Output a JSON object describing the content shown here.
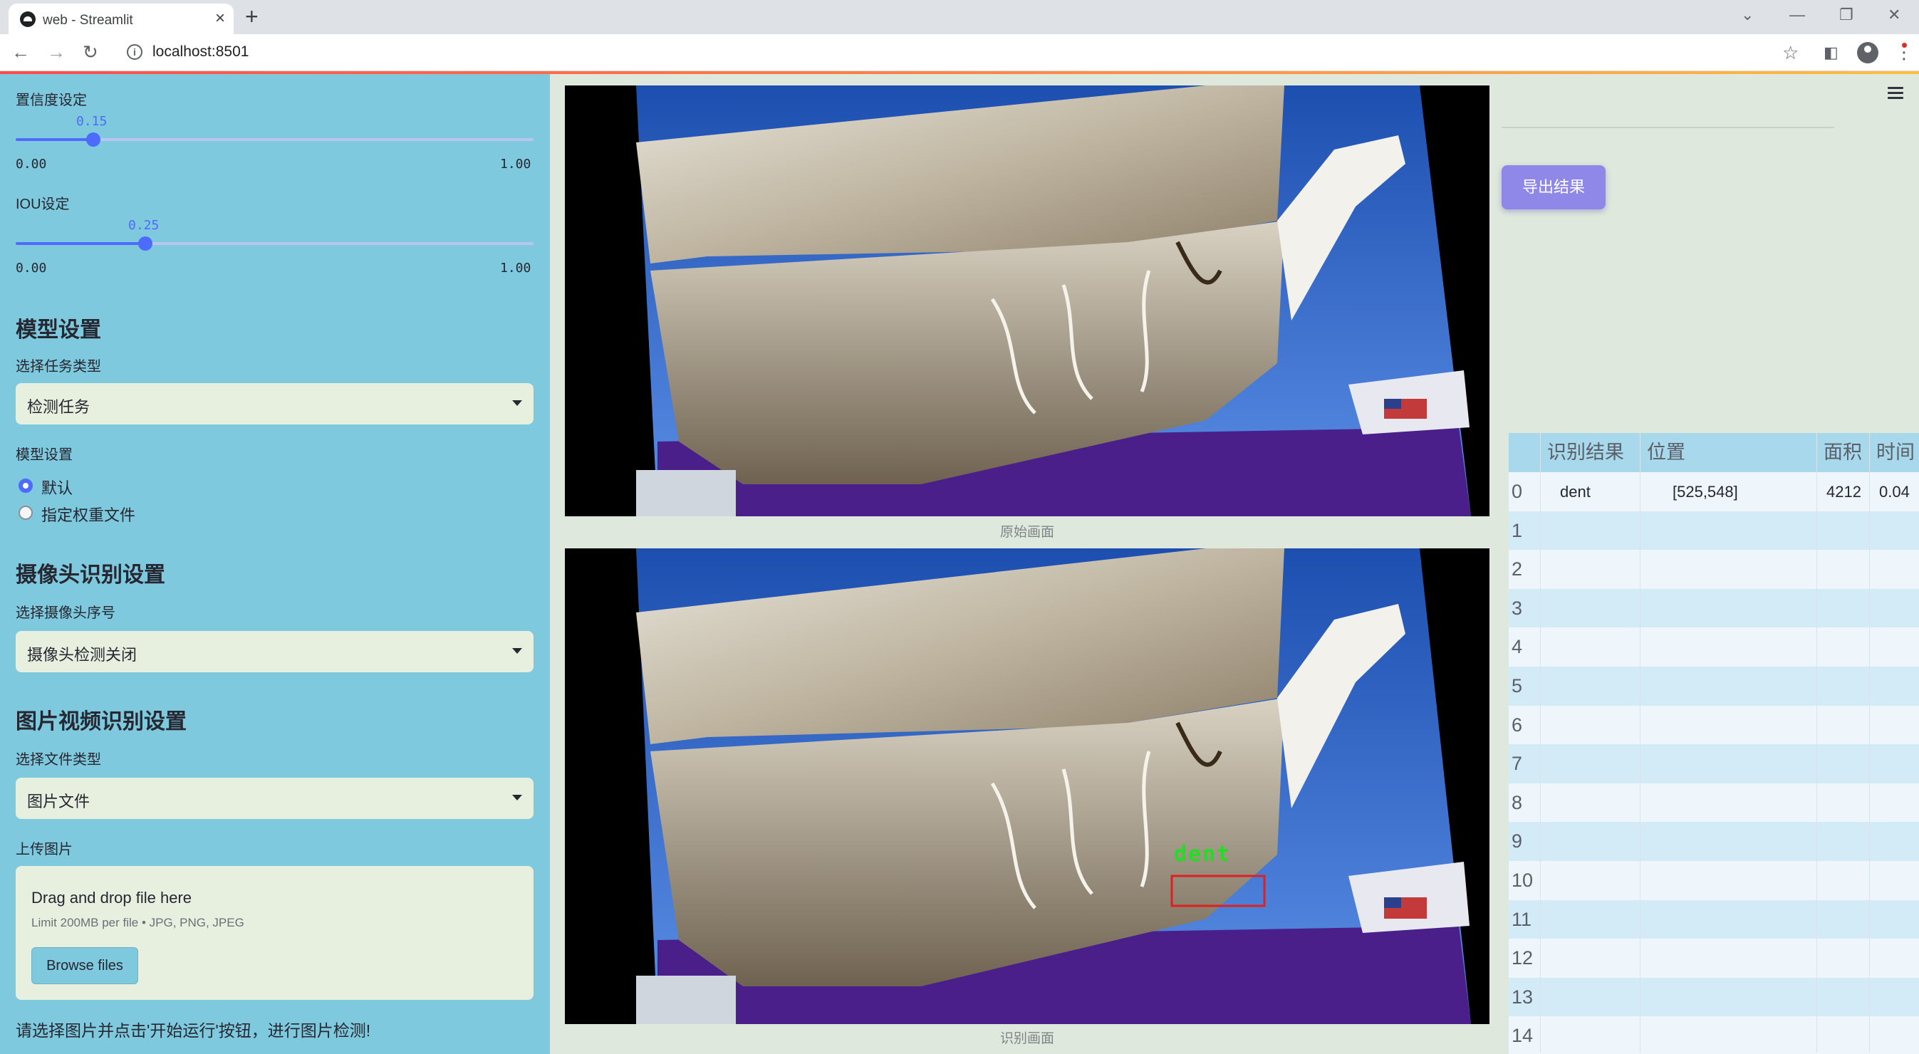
{
  "browser": {
    "tab_title": "web - Streamlit",
    "url": "localhost:8501"
  },
  "sidebar": {
    "confidence": {
      "label": "置信度设定",
      "value": "0.15",
      "min": "0.00",
      "max": "1.00",
      "fraction": 0.15
    },
    "iou": {
      "label": "IOU设定",
      "value": "0.25",
      "min": "0.00",
      "max": "1.00",
      "fraction": 0.25
    },
    "model_heading": "模型设置",
    "task_label": "选择任务类型",
    "task_value": "检测任务",
    "model_label": "模型设置",
    "model_options": [
      {
        "label": "默认",
        "checked": true
      },
      {
        "label": "指定权重文件",
        "checked": false
      }
    ],
    "camera_heading": "摄像头识别设置",
    "camera_label": "选择摄像头序号",
    "camera_value": "摄像头检测关闭",
    "media_heading": "图片视频识别设置",
    "file_type_label": "选择文件类型",
    "file_type_value": "图片文件",
    "upload_label": "上传图片",
    "upload_main": "Drag and drop file here",
    "upload_sub": "Limit 200MB per file • JPG, PNG, JPEG",
    "browse_label": "Browse files",
    "bottom_hint": "请选择图片并点击'开始运行'按钮，进行图片检测!"
  },
  "main": {
    "caption_original": "原始画面",
    "caption_detected": "识别画面",
    "detection_label": "dent"
  },
  "right": {
    "export_label": "导出结果",
    "table": {
      "headers": [
        "识别结果",
        "位置",
        "面积",
        "时间"
      ],
      "rows": [
        {
          "index": "0",
          "result": "dent",
          "position": "[525,548]",
          "area": "4212",
          "time": "0.04"
        },
        {
          "index": "1"
        },
        {
          "index": "2"
        },
        {
          "index": "3"
        },
        {
          "index": "4"
        },
        {
          "index": "5"
        },
        {
          "index": "6"
        },
        {
          "index": "7"
        },
        {
          "index": "8"
        },
        {
          "index": "9"
        },
        {
          "index": "10"
        },
        {
          "index": "11"
        },
        {
          "index": "12"
        },
        {
          "index": "13"
        },
        {
          "index": "14"
        }
      ]
    }
  },
  "colors": {
    "sidebar_bg": "#7ec9de",
    "accent": "#4d6bfe",
    "export_button": "#8f88e8",
    "detection_box": "#e02020",
    "detection_text": "#22dd22"
  }
}
